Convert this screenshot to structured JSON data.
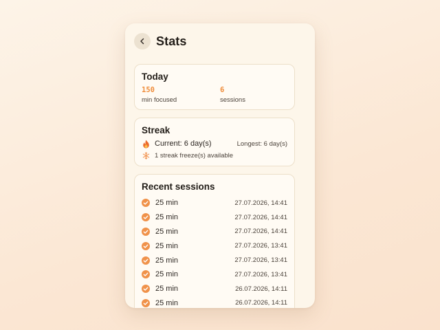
{
  "header": {
    "title": "Stats",
    "back_icon": "chevron-left-icon"
  },
  "today": {
    "title": "Today",
    "minutes_value": "150",
    "minutes_label": "min focused",
    "sessions_value": "6",
    "sessions_label": "sessions"
  },
  "streak": {
    "title": "Streak",
    "current": "Current: 6 day(s)",
    "longest": "Longest: 6 day(s)",
    "freeze": "1 streak freeze(s) available",
    "current_icon": "flame-icon",
    "freeze_icon": "snowflake-icon"
  },
  "recent": {
    "title": "Recent sessions",
    "sessions": [
      {
        "duration": "25 min",
        "timestamp": "27.07.2026, 14:41"
      },
      {
        "duration": "25 min",
        "timestamp": "27.07.2026, 14:41"
      },
      {
        "duration": "25 min",
        "timestamp": "27.07.2026, 14:41"
      },
      {
        "duration": "25 min",
        "timestamp": "27.07.2026, 13:41"
      },
      {
        "duration": "25 min",
        "timestamp": "27.07.2026, 13:41"
      },
      {
        "duration": "25 min",
        "timestamp": "27.07.2026, 13:41"
      },
      {
        "duration": "25 min",
        "timestamp": "26.07.2026, 14:11"
      },
      {
        "duration": "25 min",
        "timestamp": "26.07.2026, 14:11"
      }
    ]
  },
  "colors": {
    "accent": "#ef8c3a",
    "background": "#fdf6ea",
    "card": "#fffbf4"
  }
}
